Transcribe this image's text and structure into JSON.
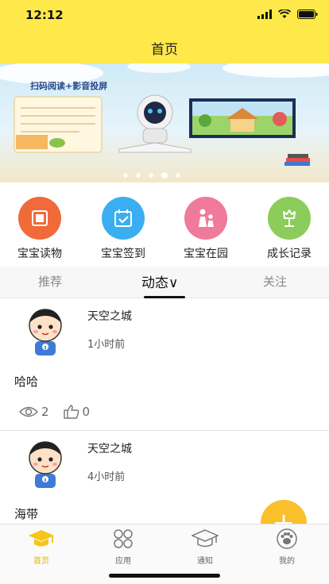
{
  "status_bar": {
    "time": "12:12"
  },
  "header": {
    "title": "首页"
  },
  "banner": {
    "caption": "扫码阅读+影音投屏",
    "slides": 5,
    "active_slide": 3
  },
  "quick_actions": [
    {
      "label": "宝宝读物",
      "icon": "book-icon",
      "color": "#f06a3a"
    },
    {
      "label": "宝宝签到",
      "icon": "calendar-check-icon",
      "color": "#3aaef0"
    },
    {
      "label": "宝宝在园",
      "icon": "parent-child-icon",
      "color": "#f07a9a"
    },
    {
      "label": "成长记录",
      "icon": "flower-icon",
      "color": "#8ccc5a"
    }
  ],
  "tabs": [
    {
      "label": "推荐",
      "active": false
    },
    {
      "label": "动态∨",
      "active": true
    },
    {
      "label": "关注",
      "active": false
    }
  ],
  "posts": [
    {
      "name": "天空之城",
      "time": "1小时前",
      "text": "哈哈",
      "views": "2",
      "likes": "0"
    },
    {
      "name": "天空之城",
      "time": "4小时前",
      "text": "海带"
    }
  ],
  "fab": {
    "label": "+"
  },
  "tabbar": [
    {
      "label": "首页",
      "icon": "graduation-cap-filled-icon",
      "active": true
    },
    {
      "label": "应用",
      "icon": "apps-grid-icon",
      "active": false
    },
    {
      "label": "通知",
      "icon": "graduation-cap-outline-icon",
      "active": false
    },
    {
      "label": "我的",
      "icon": "paw-profile-icon",
      "active": false
    }
  ],
  "colors": {
    "header": "#ffe94a",
    "accent": "#f9c02c",
    "active_tab_label": "#e7b200"
  }
}
